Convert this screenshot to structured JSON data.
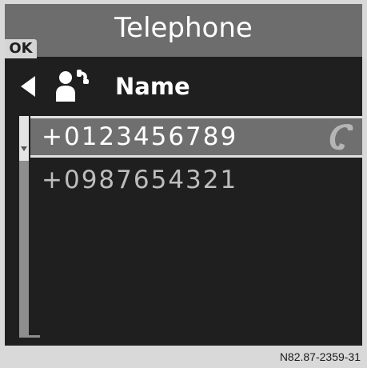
{
  "header": {
    "title": "Telephone",
    "ok_label": "OK"
  },
  "toolbar": {
    "back_icon": "back-arrow-icon",
    "contact_icon": "contact-call-icon",
    "sort_label": "Name"
  },
  "entries": [
    {
      "number": "+0123456789",
      "selected": true,
      "icon": "handset-icon"
    },
    {
      "number": "+0987654321",
      "selected": false
    }
  ],
  "footer": {
    "code": "N82.87-2359-31"
  },
  "colors": {
    "screen_background": "#1f1f1f",
    "header_background": "#6d6d6d",
    "selection_background": "#6f6f6f",
    "frame_background": "#d9d9d9"
  }
}
